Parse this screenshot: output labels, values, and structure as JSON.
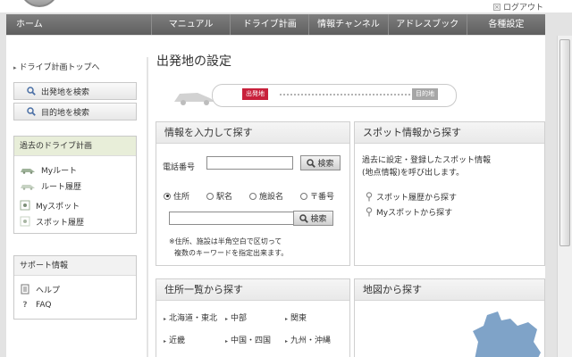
{
  "header": {
    "logout_label": "ログアウト"
  },
  "nav": {
    "home": "ホーム",
    "items": [
      "マニュアル",
      "ドライブ計画",
      "情報チャンネル",
      "アドレスブック",
      "各種設定"
    ]
  },
  "sidebar": {
    "top_link": "ドライブ計画トップへ",
    "search_start": "出発地を検索",
    "search_dest": "目的地を検索",
    "past_plans": {
      "title": "過去のドライブ計画",
      "items": [
        "Myルート",
        "ルート履歴",
        "Myスポット",
        "スポット履歴"
      ]
    },
    "support": {
      "title": "サポート情報",
      "items": [
        "ヘルプ",
        "FAQ"
      ]
    }
  },
  "main": {
    "title": "出発地の設定",
    "route": {
      "start_tag": "出発地",
      "end_tag": "目的地"
    },
    "input_search": {
      "title": "情報を入力して探す",
      "phone_label": "電話番号",
      "phone_value": "",
      "search_button": "検索",
      "radios": [
        "住所",
        "駅名",
        "施設名",
        "〒番号"
      ],
      "selected_radio": "住所",
      "keyword_value": "",
      "note_line1": "※住所、施設は半角空白で区切って",
      "note_line2": "複数のキーワードを指定出来ます。"
    },
    "spot_search": {
      "title": "スポット情報から探す",
      "desc_line1": "過去に設定・登録したスポット情報",
      "desc_line2": "(地点情報)を呼び出します。",
      "links": [
        "スポット履歴から探す",
        "Myスポットから探す"
      ]
    },
    "address_search": {
      "title": "住所一覧から探す",
      "regions": [
        "北海道・東北",
        "中部",
        "関東",
        "近畿",
        "中国・四国",
        "九州・沖縄"
      ]
    },
    "map_search": {
      "title": "地図から探す"
    }
  },
  "colors": {
    "accent_red": "#c8203b",
    "nav_gray": "#6b6b6b",
    "past_plans_bg": "#e8eed9",
    "map_blue": "#7fa3c8"
  }
}
